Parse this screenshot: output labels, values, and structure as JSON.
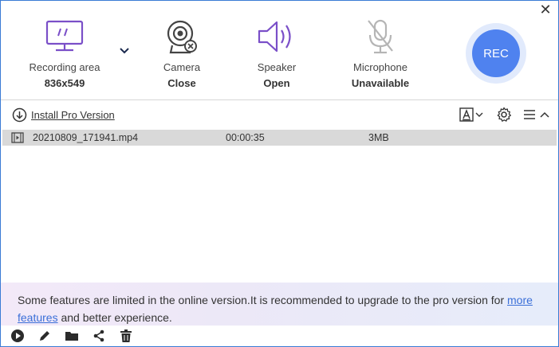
{
  "window": {
    "close_label": "✕"
  },
  "toolbar": {
    "recording_area": {
      "label": "Recording area",
      "value": "836x549"
    },
    "camera": {
      "label": "Camera",
      "value": "Close"
    },
    "speaker": {
      "label": "Speaker",
      "value": "Open"
    },
    "microphone": {
      "label": "Microphone",
      "value": "Unavailable"
    },
    "rec_label": "REC"
  },
  "actions": {
    "install_label": "Install Pro Version"
  },
  "files": [
    {
      "name": "20210809_171941.mp4",
      "duration": "00:00:35",
      "size": "3MB"
    }
  ],
  "notice": {
    "text_before": "Some features are limited in the online version.It is recommended to upgrade to the pro version for ",
    "link_text": "more features",
    "text_after": " and better experience."
  },
  "colors": {
    "accent": "#4f82ef",
    "icon_purple": "#7a4fc8",
    "link": "#3a6fd8"
  },
  "icons": [
    "close-icon",
    "screen-icon",
    "chevron-down-icon",
    "webcam-icon",
    "speaker-icon",
    "microphone-muted-icon",
    "download-icon",
    "text-style-icon",
    "gear-icon",
    "menu-icon",
    "chevron-up-icon",
    "video-file-icon",
    "play-icon",
    "pencil-icon",
    "folder-icon",
    "share-icon",
    "trash-icon"
  ]
}
